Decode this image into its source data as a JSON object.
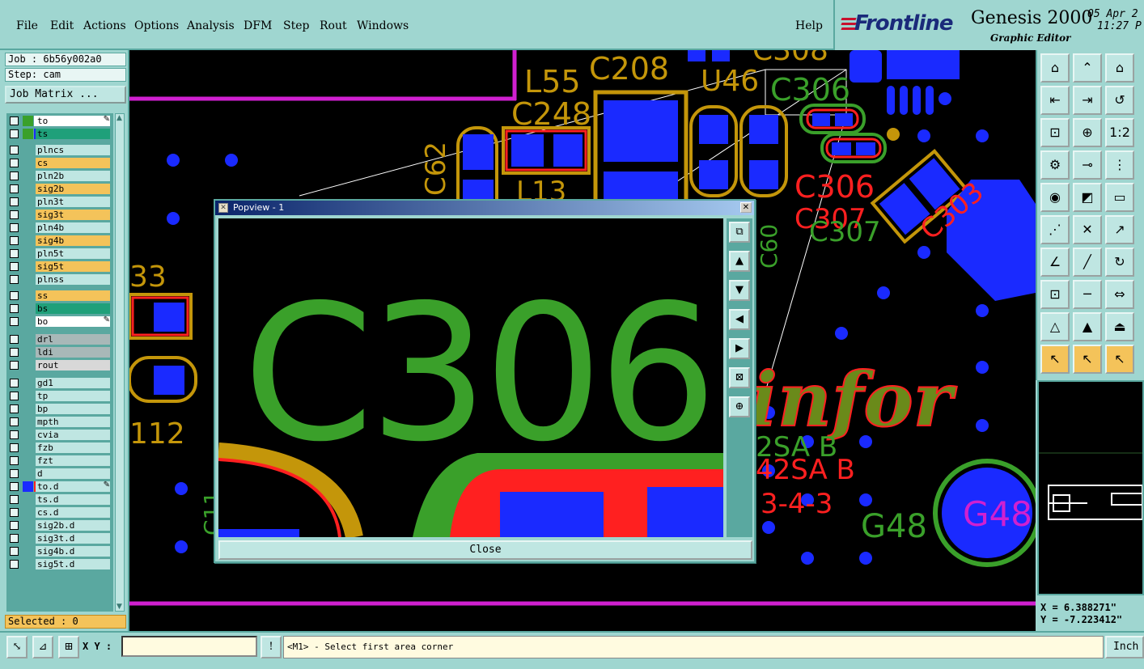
{
  "menubar": {
    "items": [
      "File",
      "Edit",
      "Actions",
      "Options",
      "Analysis",
      "DFM",
      "Step",
      "Rout",
      "Windows"
    ],
    "help": "Help"
  },
  "brand": {
    "logo": "Frontline",
    "product": "Genesis 2000",
    "subtitle": "Graphic Editor",
    "date": "05 Apr 2",
    "time": "11:27 P"
  },
  "job": {
    "job_label": "Job : 6b56y002a0",
    "step_label": "Step: cam",
    "matrix_button": "Job Matrix ..."
  },
  "layers": [
    {
      "name": "to",
      "bg": "#ffffff",
      "sw1": "#3aa02a",
      "sw2": "#ffffff",
      "edit": true
    },
    {
      "name": "ts",
      "bg": "#1fa07a",
      "sw1": "#3aa02a",
      "sw2": "#1a2aff"
    },
    {
      "name": "plncs",
      "bg": "#bfe6e2"
    },
    {
      "name": "cs",
      "bg": "#f4c35a"
    },
    {
      "name": "pln2b",
      "bg": "#bfe6e2"
    },
    {
      "name": "sig2b",
      "bg": "#f4c35a"
    },
    {
      "name": "pln3t",
      "bg": "#bfe6e2"
    },
    {
      "name": "sig3t",
      "bg": "#f4c35a"
    },
    {
      "name": "pln4b",
      "bg": "#bfe6e2"
    },
    {
      "name": "sig4b",
      "bg": "#f4c35a"
    },
    {
      "name": "pln5t",
      "bg": "#bfe6e2"
    },
    {
      "name": "sig5t",
      "bg": "#f4c35a"
    },
    {
      "name": "plnss",
      "bg": "#bfe6e2"
    },
    {
      "name": "ss",
      "bg": "#f4c35a"
    },
    {
      "name": "bs",
      "bg": "#1fa07a"
    },
    {
      "name": "bo",
      "bg": "#ffffff",
      "edit": true
    },
    {
      "name": "drl",
      "bg": "#a8b8b8"
    },
    {
      "name": "ldi",
      "bg": "#a8b8b8"
    },
    {
      "name": "rout",
      "bg": "#d8d8d8"
    },
    {
      "name": "gd1",
      "bg": "#bfe6e2"
    },
    {
      "name": "tp",
      "bg": "#bfe6e2"
    },
    {
      "name": "bp",
      "bg": "#bfe6e2"
    },
    {
      "name": "mpth",
      "bg": "#bfe6e2"
    },
    {
      "name": "cvia",
      "bg": "#bfe6e2"
    },
    {
      "name": "fzb",
      "bg": "#bfe6e2"
    },
    {
      "name": "fzt",
      "bg": "#bfe6e2"
    },
    {
      "name": "d",
      "bg": "#bfe6e2"
    },
    {
      "name": "to.d",
      "bg": "#bfe6e2",
      "sw1": "#1a2aff",
      "sw2": "#ff2020",
      "edit": true
    },
    {
      "name": "ts.d",
      "bg": "#bfe6e2"
    },
    {
      "name": "cs.d",
      "bg": "#bfe6e2"
    },
    {
      "name": "sig2b.d",
      "bg": "#bfe6e2"
    },
    {
      "name": "sig3t.d",
      "bg": "#bfe6e2"
    },
    {
      "name": "sig4b.d",
      "bg": "#bfe6e2"
    },
    {
      "name": "sig5t.d",
      "bg": "#bfe6e2"
    }
  ],
  "selected_label": "Selected : 0",
  "canvas_labels": {
    "l55": "L55",
    "c208": "C208",
    "u46": "U46",
    "c306": "C306",
    "c308": "C308",
    "c248": "C248",
    "c62": "C62",
    "l13": "L13",
    "c306r": "C306",
    "c307r": "C307",
    "c307g": "C307",
    "c303": "C303",
    "n33": "33",
    "n112": "112",
    "infor": "infor",
    "g48": "G48",
    "g48pad": "G48",
    "sa_b1": "2SA B",
    "sa_b2": "42SA B",
    "dash": "3-4-3",
    "c11": "C11",
    "c60": "C60"
  },
  "popview": {
    "title": "Popview - 1",
    "label": "C306",
    "close": "Close"
  },
  "coords": {
    "x": "X =  6.388271\"",
    "y": "Y = -7.223412\""
  },
  "statusbar": {
    "xy_label": "X Y :",
    "xy_value": "",
    "prompt": "<M1> - Select first area corner",
    "units": "Inch"
  }
}
